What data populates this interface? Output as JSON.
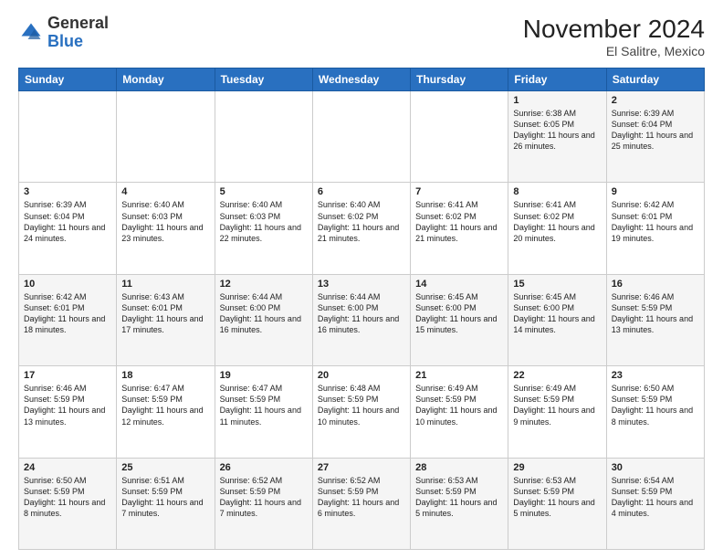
{
  "header": {
    "logo_general": "General",
    "logo_blue": "Blue",
    "month_title": "November 2024",
    "location": "El Salitre, Mexico"
  },
  "weekdays": [
    "Sunday",
    "Monday",
    "Tuesday",
    "Wednesday",
    "Thursday",
    "Friday",
    "Saturday"
  ],
  "weeks": [
    [
      {
        "day": "",
        "text": ""
      },
      {
        "day": "",
        "text": ""
      },
      {
        "day": "",
        "text": ""
      },
      {
        "day": "",
        "text": ""
      },
      {
        "day": "",
        "text": ""
      },
      {
        "day": "1",
        "text": "Sunrise: 6:38 AM\nSunset: 6:05 PM\nDaylight: 11 hours and 26 minutes."
      },
      {
        "day": "2",
        "text": "Sunrise: 6:39 AM\nSunset: 6:04 PM\nDaylight: 11 hours and 25 minutes."
      }
    ],
    [
      {
        "day": "3",
        "text": "Sunrise: 6:39 AM\nSunset: 6:04 PM\nDaylight: 11 hours and 24 minutes."
      },
      {
        "day": "4",
        "text": "Sunrise: 6:40 AM\nSunset: 6:03 PM\nDaylight: 11 hours and 23 minutes."
      },
      {
        "day": "5",
        "text": "Sunrise: 6:40 AM\nSunset: 6:03 PM\nDaylight: 11 hours and 22 minutes."
      },
      {
        "day": "6",
        "text": "Sunrise: 6:40 AM\nSunset: 6:02 PM\nDaylight: 11 hours and 21 minutes."
      },
      {
        "day": "7",
        "text": "Sunrise: 6:41 AM\nSunset: 6:02 PM\nDaylight: 11 hours and 21 minutes."
      },
      {
        "day": "8",
        "text": "Sunrise: 6:41 AM\nSunset: 6:02 PM\nDaylight: 11 hours and 20 minutes."
      },
      {
        "day": "9",
        "text": "Sunrise: 6:42 AM\nSunset: 6:01 PM\nDaylight: 11 hours and 19 minutes."
      }
    ],
    [
      {
        "day": "10",
        "text": "Sunrise: 6:42 AM\nSunset: 6:01 PM\nDaylight: 11 hours and 18 minutes."
      },
      {
        "day": "11",
        "text": "Sunrise: 6:43 AM\nSunset: 6:01 PM\nDaylight: 11 hours and 17 minutes."
      },
      {
        "day": "12",
        "text": "Sunrise: 6:44 AM\nSunset: 6:00 PM\nDaylight: 11 hours and 16 minutes."
      },
      {
        "day": "13",
        "text": "Sunrise: 6:44 AM\nSunset: 6:00 PM\nDaylight: 11 hours and 16 minutes."
      },
      {
        "day": "14",
        "text": "Sunrise: 6:45 AM\nSunset: 6:00 PM\nDaylight: 11 hours and 15 minutes."
      },
      {
        "day": "15",
        "text": "Sunrise: 6:45 AM\nSunset: 6:00 PM\nDaylight: 11 hours and 14 minutes."
      },
      {
        "day": "16",
        "text": "Sunrise: 6:46 AM\nSunset: 5:59 PM\nDaylight: 11 hours and 13 minutes."
      }
    ],
    [
      {
        "day": "17",
        "text": "Sunrise: 6:46 AM\nSunset: 5:59 PM\nDaylight: 11 hours and 13 minutes."
      },
      {
        "day": "18",
        "text": "Sunrise: 6:47 AM\nSunset: 5:59 PM\nDaylight: 11 hours and 12 minutes."
      },
      {
        "day": "19",
        "text": "Sunrise: 6:47 AM\nSunset: 5:59 PM\nDaylight: 11 hours and 11 minutes."
      },
      {
        "day": "20",
        "text": "Sunrise: 6:48 AM\nSunset: 5:59 PM\nDaylight: 11 hours and 10 minutes."
      },
      {
        "day": "21",
        "text": "Sunrise: 6:49 AM\nSunset: 5:59 PM\nDaylight: 11 hours and 10 minutes."
      },
      {
        "day": "22",
        "text": "Sunrise: 6:49 AM\nSunset: 5:59 PM\nDaylight: 11 hours and 9 minutes."
      },
      {
        "day": "23",
        "text": "Sunrise: 6:50 AM\nSunset: 5:59 PM\nDaylight: 11 hours and 8 minutes."
      }
    ],
    [
      {
        "day": "24",
        "text": "Sunrise: 6:50 AM\nSunset: 5:59 PM\nDaylight: 11 hours and 8 minutes."
      },
      {
        "day": "25",
        "text": "Sunrise: 6:51 AM\nSunset: 5:59 PM\nDaylight: 11 hours and 7 minutes."
      },
      {
        "day": "26",
        "text": "Sunrise: 6:52 AM\nSunset: 5:59 PM\nDaylight: 11 hours and 7 minutes."
      },
      {
        "day": "27",
        "text": "Sunrise: 6:52 AM\nSunset: 5:59 PM\nDaylight: 11 hours and 6 minutes."
      },
      {
        "day": "28",
        "text": "Sunrise: 6:53 AM\nSunset: 5:59 PM\nDaylight: 11 hours and 5 minutes."
      },
      {
        "day": "29",
        "text": "Sunrise: 6:53 AM\nSunset: 5:59 PM\nDaylight: 11 hours and 5 minutes."
      },
      {
        "day": "30",
        "text": "Sunrise: 6:54 AM\nSunset: 5:59 PM\nDaylight: 11 hours and 4 minutes."
      }
    ]
  ]
}
